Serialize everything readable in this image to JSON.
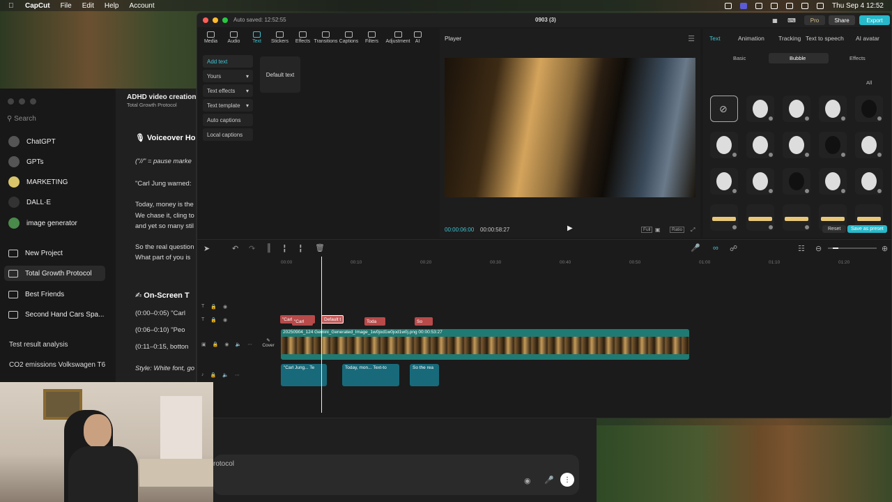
{
  "menubar": {
    "app": "CapCut",
    "items": [
      "File",
      "Edit",
      "Help",
      "Account"
    ],
    "clock": "Thu Sep 4  12:52"
  },
  "chatgpt": {
    "search": "Search",
    "items": [
      "ChatGPT",
      "GPTs",
      "MARKETING",
      "DALL·E",
      "image generator"
    ],
    "projects": [
      "New Project",
      "Total Growth Protocol",
      "Best Friends",
      "Second Hand Cars Spa..."
    ],
    "chats": [
      "Test result analysis",
      "CO2 emissions Volkswagen T6"
    ],
    "title": "ADHD video creation",
    "subtitle": "Total Growth Protocol",
    "lines": [
      "🎙 Voiceover Ho",
      "(\"//\" = pause marke",
      "\"Carl Jung warned:",
      "Today, money is the",
      "We chase it, cling to",
      "and yet so many stil",
      "So the real question",
      "What part of you is",
      "✍ On-Screen T",
      "(0:00–0:05) \"Carl",
      "(0:06–0:10) \"Peo",
      "(0:11–0:15, botton",
      "Style: White font, go"
    ],
    "composer": "rotocol"
  },
  "capcut": {
    "autosave": "Auto saved: 12:52:55",
    "project": "0903 (3)",
    "pro": "Pro",
    "share": "Share",
    "export": "Export",
    "tools": [
      "Media",
      "Audio",
      "Text",
      "Stickers",
      "Effects",
      "Transitions",
      "Captions",
      "Filters",
      "Adjustment",
      "AI"
    ],
    "left_menu": [
      "Add text",
      "Yours",
      "Text effects",
      "Text template",
      "Auto captions",
      "Local captions"
    ],
    "default_text": "Default text",
    "player": {
      "title": "Player",
      "time_current": "00:00:06:00",
      "time_total": "00:00:58:27",
      "full": "Full",
      "ratio": "Ratio"
    },
    "props": {
      "tabs": [
        "Text",
        "Animation",
        "Tracking",
        "Text to speech",
        "AI avatar"
      ],
      "subtabs": [
        "Basic",
        "Bubble",
        "Effects"
      ],
      "filter": "All",
      "reset": "Reset",
      "save_preset": "Save as preset"
    },
    "timeline": {
      "ruler": [
        "00:00",
        "00:10",
        "00:20",
        "00:30",
        "00:40",
        "00:50",
        "01:00",
        "01:10",
        "01:20"
      ],
      "cover": "Cover",
      "text_clips": [
        "\"Carl Jung war",
        "Default t"
      ],
      "text_clips2": [
        "\"Carl",
        "Toda",
        "So"
      ],
      "video_label": "20250904_124  Gemini_Generated_Image_1w0jod1w0jod1w0j.png  00:00:53:27",
      "audio_clips": [
        "\"Carl Jung...  Te",
        "Today, mon...  Text-to",
        "So the rea"
      ]
    }
  }
}
